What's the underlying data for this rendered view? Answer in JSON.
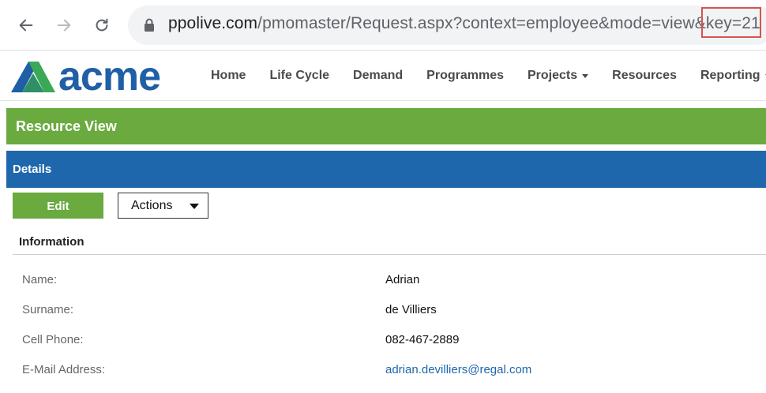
{
  "browser": {
    "url_domain": "ppolive.com",
    "url_path": "/pmomaster/Request.aspx?context=employee&mode=view&key=21"
  },
  "app": {
    "logo_text": "acme",
    "nav": [
      {
        "label": "Home"
      },
      {
        "label": "Life Cycle"
      },
      {
        "label": "Demand"
      },
      {
        "label": "Programmes"
      },
      {
        "label": "Projects",
        "dropdown": true
      },
      {
        "label": "Resources"
      },
      {
        "label": "Reporting",
        "dropdown": true
      }
    ]
  },
  "page": {
    "title": "Resource View",
    "panel_title": "Details",
    "edit_label": "Edit",
    "actions_label": "Actions",
    "section_title": "Information",
    "fields": [
      {
        "label": "Name:",
        "value": "Adrian"
      },
      {
        "label": "Surname:",
        "value": "de Villiers"
      },
      {
        "label": "Cell Phone:",
        "value": "082-467-2889"
      },
      {
        "label": "E-Mail Address:",
        "value": "adrian.devilliers@regal.com"
      }
    ]
  },
  "colors": {
    "green": "#6aaa3f",
    "blue": "#1e67ad",
    "highlight": "#d9534f",
    "logo_blue": "#1f5fa6",
    "logo_green": "#3aa857"
  }
}
